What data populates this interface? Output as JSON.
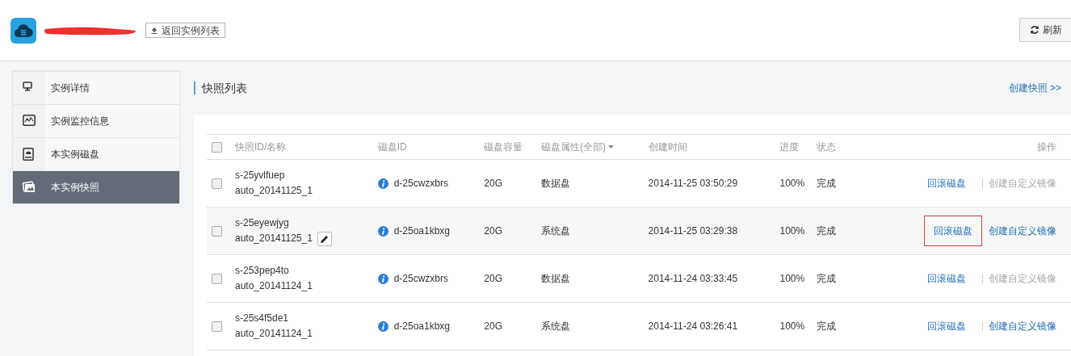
{
  "header": {
    "back_button": "返回实例列表",
    "refresh_button": "刷新"
  },
  "sidebar": {
    "items": [
      {
        "label": "实例详情",
        "selected": false
      },
      {
        "label": "实例监控信息",
        "selected": false
      },
      {
        "label": "本实例磁盘",
        "selected": false
      },
      {
        "label": "本实例快照",
        "selected": true
      }
    ]
  },
  "section": {
    "title": "快照列表",
    "create_link": "创建快照 >>"
  },
  "table": {
    "columns": [
      "快照ID/名称",
      "磁盘ID",
      "磁盘容量",
      "磁盘属性(全部)",
      "创建时间",
      "进度",
      "状态",
      "操作"
    ],
    "select_all_checked": false,
    "rows": [
      {
        "checked": false,
        "highlighted": false,
        "snapshot_id": "s-25yvlfuep",
        "name": "auto_20141125_1",
        "disk_id": "d-25cwzxbrs",
        "capacity": "20G",
        "attribute": "数据盘",
        "created": "2014-11-25 03:50:29",
        "progress": "100%",
        "status": "完成",
        "rollback": "回滚磁盘",
        "custom_image": "创建自定义镜像",
        "custom_image_disabled": true,
        "annotated": false
      },
      {
        "checked": false,
        "highlighted": true,
        "snapshot_id": "s-25eyewjyg",
        "name": "auto_20141125_1",
        "disk_id": "d-25oa1kbxg",
        "capacity": "20G",
        "attribute": "系统盘",
        "created": "2014-11-25 03:29:38",
        "progress": "100%",
        "status": "完成",
        "rollback": "回滚磁盘",
        "custom_image": "创建自定义镜像",
        "custom_image_disabled": false,
        "annotated": true
      },
      {
        "checked": false,
        "highlighted": false,
        "snapshot_id": "s-253pep4to",
        "name": "auto_20141124_1",
        "disk_id": "d-25cwzxbrs",
        "capacity": "20G",
        "attribute": "数据盘",
        "created": "2014-11-24 03:33:45",
        "progress": "100%",
        "status": "完成",
        "rollback": "回滚磁盘",
        "custom_image": "创建自定义镜像",
        "custom_image_disabled": true,
        "annotated": false
      },
      {
        "checked": false,
        "highlighted": false,
        "snapshot_id": "s-25s4f5de1",
        "name": "auto_20141124_1",
        "disk_id": "d-25oa1kbxg",
        "capacity": "20G",
        "attribute": "系统盘",
        "created": "2014-11-24 03:26:41",
        "progress": "100%",
        "status": "完成",
        "rollback": "回滚磁盘",
        "custom_image": "创建自定义镜像",
        "custom_image_disabled": false,
        "annotated": false
      }
    ]
  }
}
